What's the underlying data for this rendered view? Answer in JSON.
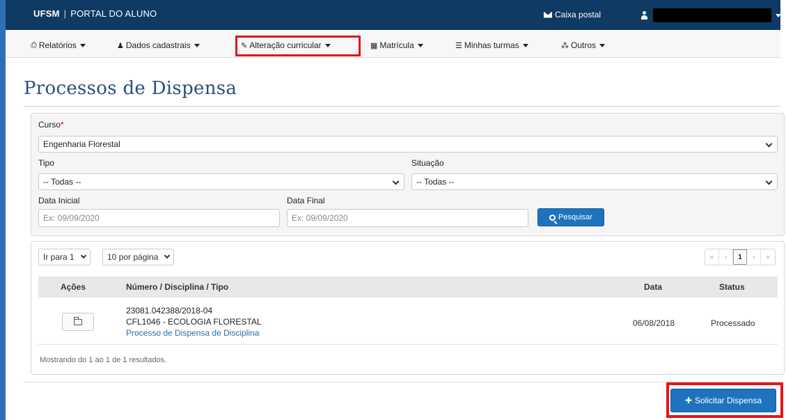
{
  "topbar": {
    "brand_strong": "UFSM",
    "brand_sep": "|",
    "brand_rest": "PORTAL DO ALUNO",
    "mail_label": "Caixa postal"
  },
  "menu": {
    "items": [
      {
        "label": "Relatórios",
        "icon": "print-icon"
      },
      {
        "label": "Dados cadastrais",
        "icon": "user-icon"
      },
      {
        "label": "Alteração curricular",
        "icon": "edit-icon"
      },
      {
        "label": "Matrícula",
        "icon": "table-icon"
      },
      {
        "label": "Minhas turmas",
        "icon": "list-icon"
      },
      {
        "label": "Outros",
        "icon": "sitemap-icon"
      }
    ]
  },
  "page": {
    "title": "Processos de Dispensa"
  },
  "filters": {
    "curso_label": "Curso",
    "curso_required": "*",
    "curso_value": "Engenharia Florestal",
    "tipo_label": "Tipo",
    "tipo_value": "-- Todas --",
    "situacao_label": "Situação",
    "situacao_value": "-- Todas --",
    "data_inicial_label": "Data Inicial",
    "data_inicial_placeholder": "Ex: 09/09/2020",
    "data_final_label": "Data Final",
    "data_final_placeholder": "Ex: 09/09/2020",
    "search_button": "Pesquisar"
  },
  "results": {
    "goto_page": "Ir para 1",
    "per_page": "10 por página",
    "pager": [
      "«",
      "‹",
      "1",
      "›",
      "»"
    ],
    "columns": [
      "Ações",
      "Número / Disciplina / Tipo",
      "Data",
      "Status"
    ],
    "rows": [
      {
        "numero": "23081.042388/2018-04",
        "disciplina": "CFL1046 - ECOLOGIA FLORESTAL",
        "tipo": "Processo de Dispensa de Disciplina",
        "data": "06/08/2018",
        "status": "Processado"
      }
    ],
    "footer": "Mostrando do 1 ao 1 de 1 resultados."
  },
  "actions": {
    "solicitar_label": "Solicitar Dispensa"
  },
  "colors": {
    "topbar": "#0f3a63",
    "primary": "#1e73be",
    "highlight": "#e3141b",
    "title": "#2a5079"
  }
}
